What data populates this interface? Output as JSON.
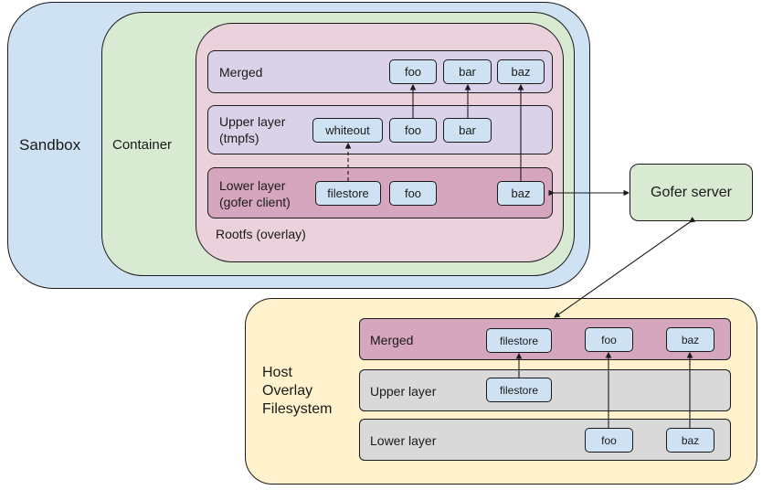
{
  "colors": {
    "sandbox": "#cfe2f3",
    "container": "#d9ead3",
    "rootfs": "#ead1dc",
    "layer_light": "#d9d2e9",
    "layer_dark": "#d5a6bd",
    "file": "#cfe2f3",
    "gofer": "#d9ead3",
    "host": "#fff2cc",
    "host_layer": "#d9d9d9"
  },
  "sandbox": {
    "label": "Sandbox"
  },
  "container": {
    "label": "Container"
  },
  "rootfs": {
    "label": "Rootfs (overlay)",
    "merged": {
      "label": "Merged",
      "files": [
        "foo",
        "bar",
        "baz"
      ]
    },
    "upper": {
      "label": "Upper layer\n(tmpfs)",
      "files": [
        "whiteout",
        "foo",
        "bar"
      ]
    },
    "lower": {
      "label": "Lower layer\n(gofer client)",
      "files": [
        "filestore",
        "foo",
        "baz"
      ]
    }
  },
  "gofer": {
    "label": "Gofer server"
  },
  "host": {
    "label": "Host\nOverlay\nFilesystem",
    "merged": {
      "label": "Merged",
      "files": [
        "filestore",
        "foo",
        "baz"
      ]
    },
    "upper": {
      "label": "Upper layer",
      "files": [
        "filestore"
      ]
    },
    "lower": {
      "label": "Lower layer",
      "files": [
        "foo",
        "baz"
      ]
    }
  }
}
